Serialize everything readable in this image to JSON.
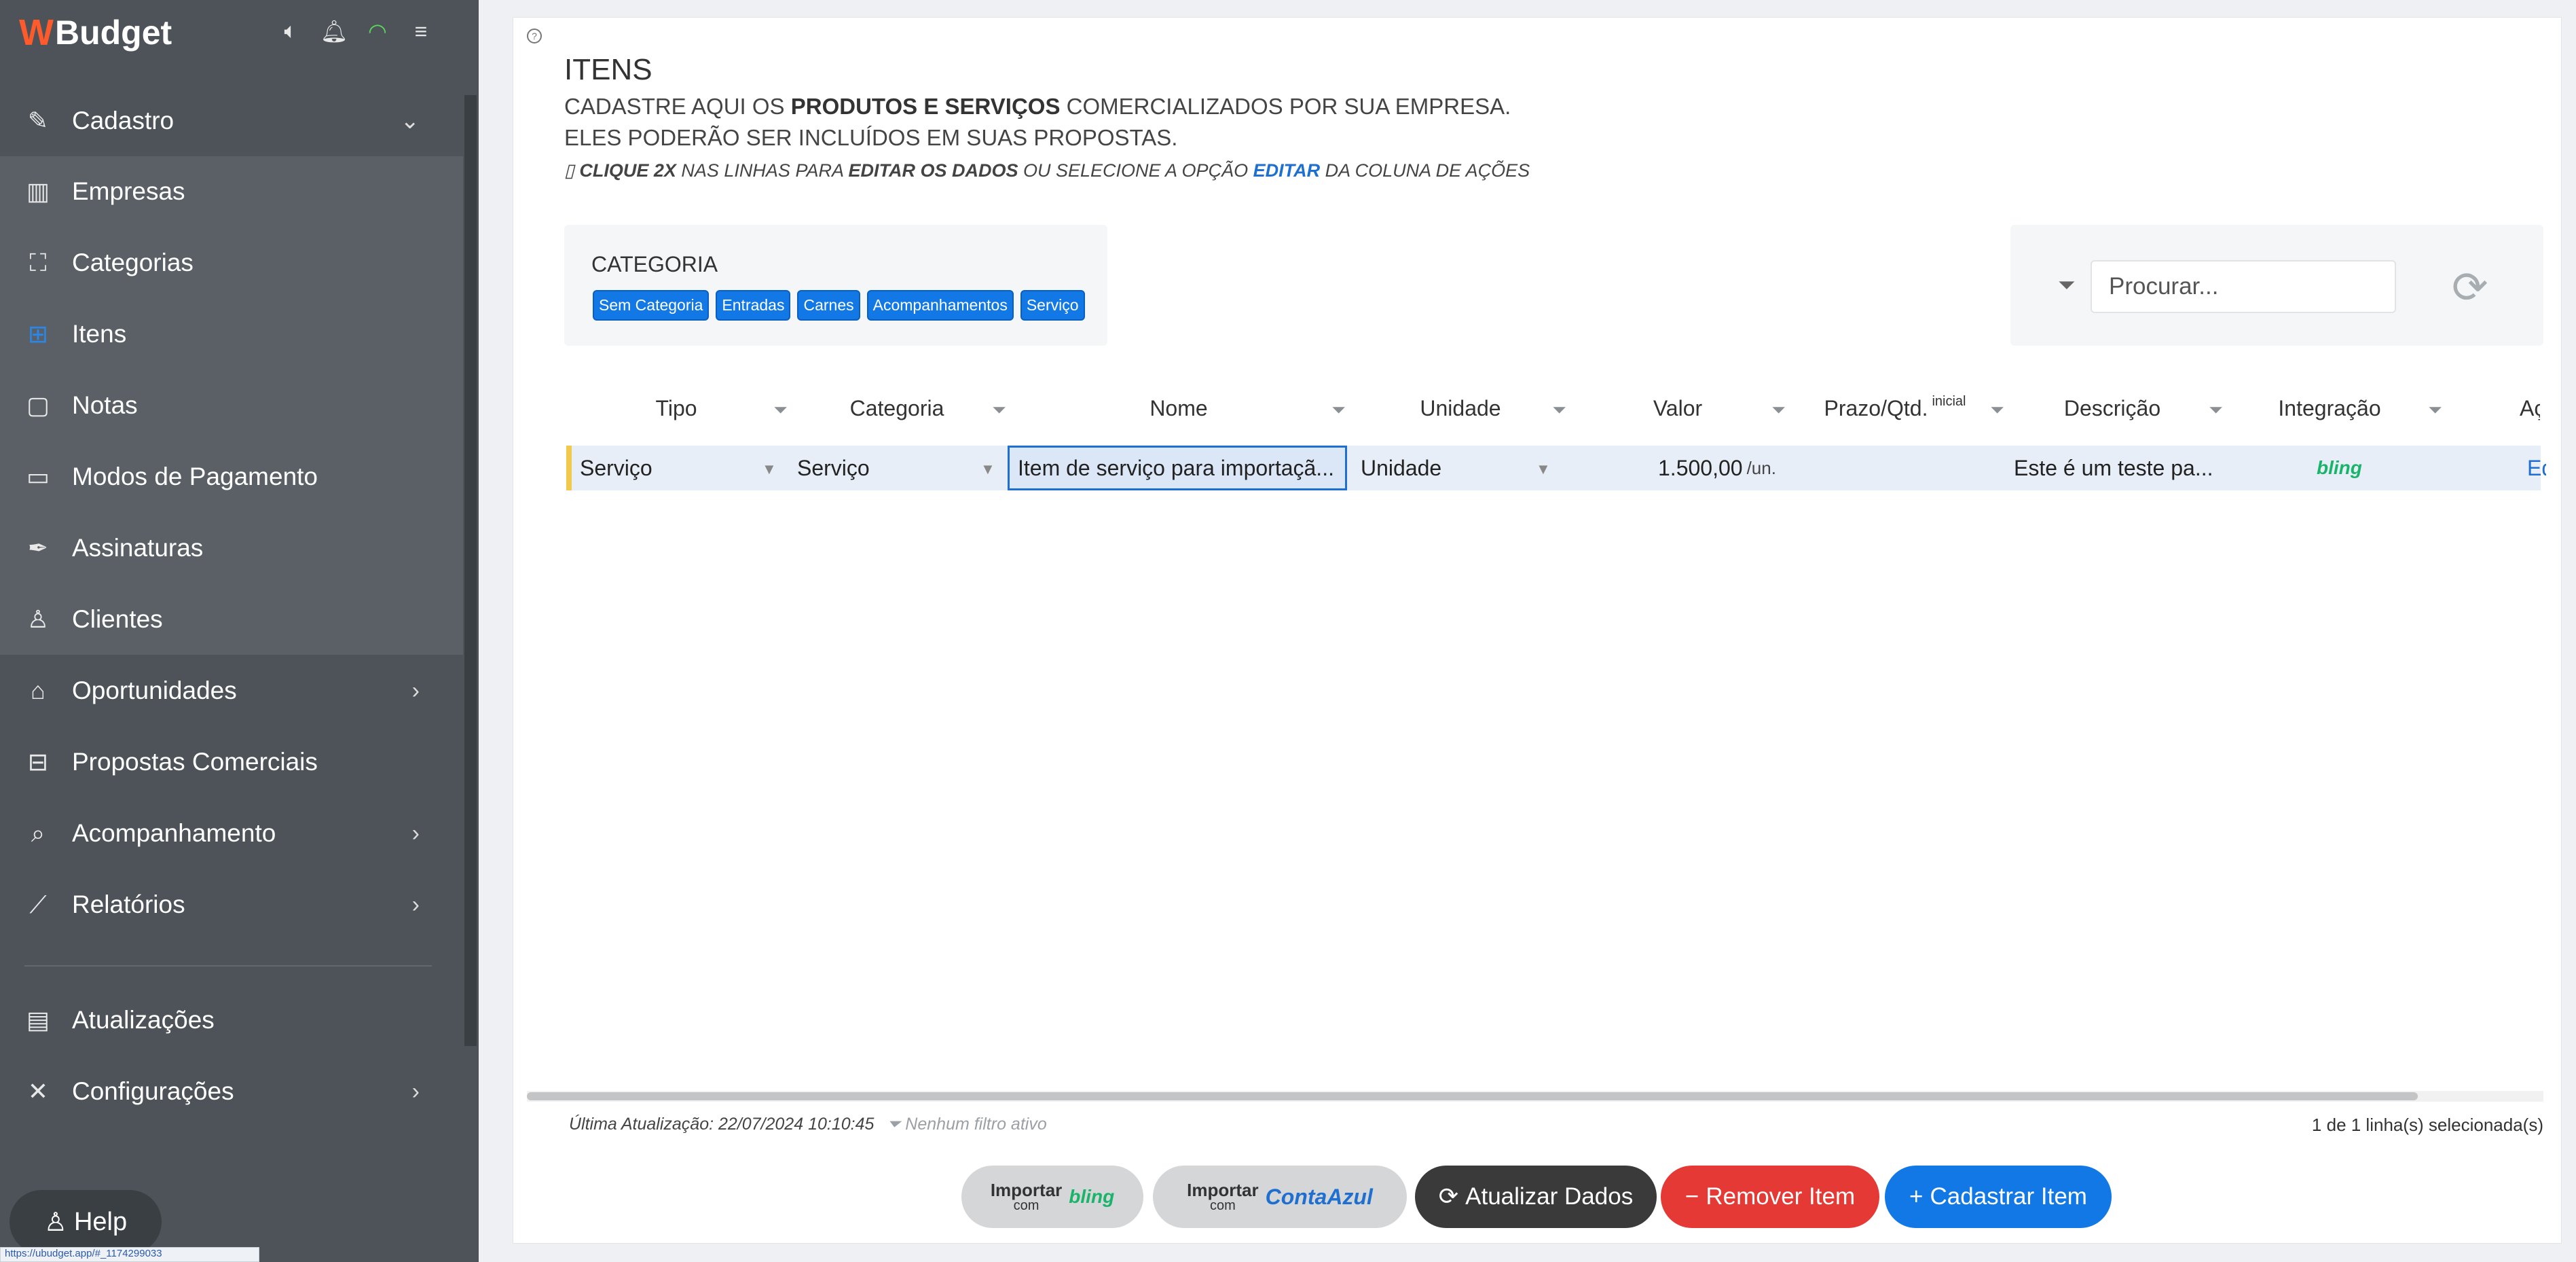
{
  "app": {
    "logo_text": "Budget"
  },
  "sidebar": {
    "items": [
      {
        "label": "Cadastro",
        "icon": "edit-icon",
        "arrow": "⌄"
      },
      {
        "label": "Empresas",
        "icon": "building-icon"
      },
      {
        "label": "Categorias",
        "icon": "hierarchy-icon"
      },
      {
        "label": "Itens",
        "icon": "grid-icon"
      },
      {
        "label": "Notas",
        "icon": "note-icon"
      },
      {
        "label": "Modos de Pagamento",
        "icon": "money-icon"
      },
      {
        "label": "Assinaturas",
        "icon": "pen-icon"
      },
      {
        "label": "Clientes",
        "icon": "user-icon"
      },
      {
        "label": "Oportunidades",
        "icon": "tag-icon",
        "arrow": "›"
      },
      {
        "label": "Propostas Comerciais",
        "icon": "briefcase-icon"
      },
      {
        "label": "Acompanhamento",
        "icon": "search-doc-icon",
        "arrow": "›"
      },
      {
        "label": "Relatórios",
        "icon": "chart-icon",
        "arrow": "›"
      },
      {
        "label": "Atualizações",
        "icon": "newspaper-icon"
      },
      {
        "label": "Configurações",
        "icon": "tools-icon",
        "arrow": "›"
      }
    ],
    "help_label": "Help",
    "status_url": "https://ubudget.app/#_1174299033"
  },
  "page": {
    "title": "ITENS",
    "sub1_pre": "CADASTRE AQUI OS ",
    "sub1_bold": "PRODUTOS E SERVIÇOS",
    "sub1_post": " COMERCIALIZADOS POR SUA EMPRESA.",
    "sub2": "ELES PODERÃO SER INCLUÍDOS EM SUAS PROPOSTAS.",
    "hint_a": "CLIQUE 2X",
    "hint_b": " NAS LINHAS PARA ",
    "hint_c": "EDITAR OS DADOS",
    "hint_d": " OU SELECIONE A OPÇÃO ",
    "hint_e": "EDITAR",
    "hint_f": " DA COLUNA DE AÇÕES"
  },
  "category": {
    "title": "CATEGORIA",
    "chips": [
      "Sem Categoria",
      "Entradas",
      "Carnes",
      "Acompanhamentos",
      "Serviço"
    ]
  },
  "search": {
    "placeholder": "Procurar..."
  },
  "table": {
    "columns": [
      "Tipo",
      "Categoria",
      "Nome",
      "Unidade",
      "Valor",
      "Prazo/Qtd.",
      "Descrição",
      "Integração",
      "Ações"
    ],
    "prazo_sup": "inicial",
    "rows": [
      {
        "tipo": "Serviço",
        "categoria": "Serviço",
        "nome": "Item de serviço para importaçã...",
        "unidade": "Unidade",
        "valor": "1.500,00",
        "valor_unit": "/un.",
        "prazo": "",
        "descricao": "Este é um teste pa...",
        "integracao": "bling",
        "acoes": "Editar"
      }
    ]
  },
  "status": {
    "last_update": "Última Atualização: 22/07/2024 10:10:45",
    "filter": "Nenhum filtro ativo",
    "selected": "1 de 1 linha(s) selecionada(s)"
  },
  "buttons": {
    "import_label": "Importar",
    "import_com": "com",
    "bling": "bling",
    "contaazul": "ContaAzul",
    "refresh": "Atualizar Dados",
    "remove": "Remover Item",
    "add": "Cadastrar Item"
  }
}
